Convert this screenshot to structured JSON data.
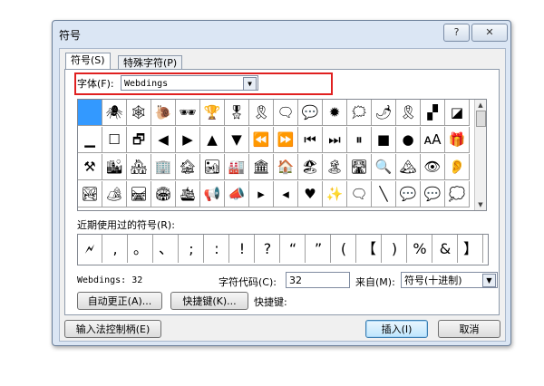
{
  "window": {
    "title": "符号",
    "help_label": "?",
    "close_label": "☒"
  },
  "tabs": [
    {
      "label": "符号(S)",
      "active": true
    },
    {
      "label": "特殊字符(P)",
      "active": false
    }
  ],
  "font": {
    "label": "字体(F):",
    "value": "Webdings"
  },
  "symbol_grid": {
    "rows": [
      [
        "",
        "🕷",
        "🕸",
        "🐌",
        "🕶",
        "🏆",
        "🎖",
        "🎗",
        "🗨",
        "💬",
        "✹",
        "🗯",
        "🌶",
        "🎗",
        "▞",
        "◪"
      ],
      [
        "▁",
        "☐",
        "🗗",
        "◀",
        "▶",
        "▲",
        "▼",
        "⏪",
        "⏩",
        "⏮",
        "⏭",
        "⏸",
        "■",
        "●",
        "ᴀA",
        "🎁"
      ],
      [
        "⚒",
        "🏙",
        "🏘",
        "🏢",
        "🏚",
        "🏜",
        "🏭",
        "🏛",
        "🏠",
        "🏖",
        "🏝",
        "🛣",
        "🔍",
        "🏔",
        "👁",
        "👂"
      ],
      [
        "🏞",
        "🏕",
        "🛤",
        "🏟",
        "🛳",
        "📢",
        "📣",
        "▸",
        "◂",
        "♥",
        "✨",
        "🗨",
        "╲",
        "💬",
        "💬",
        "💭"
      ]
    ],
    "selected_index": 0
  },
  "recent": {
    "label": "近期使用过的符号(R):",
    "symbols": [
      "🗲",
      ",",
      "。",
      "、",
      ";",
      ":",
      "!",
      "?",
      "“",
      "”",
      "(",
      "【",
      ")",
      "%",
      "&",
      "】"
    ]
  },
  "info": {
    "char_name": "Webdings: 32",
    "code_label": "字符代码(C):",
    "code_value": "32",
    "from_label": "来自(M):",
    "from_value": "符号(十进制)"
  },
  "buttons": {
    "autocorrect": "自动更正(A)...",
    "shortcut_key": "快捷键(K)...",
    "shortcut_label": "快捷键:",
    "ime_handle": "输入法控制柄(E)",
    "insert": "插入(I)",
    "cancel": "取消"
  }
}
